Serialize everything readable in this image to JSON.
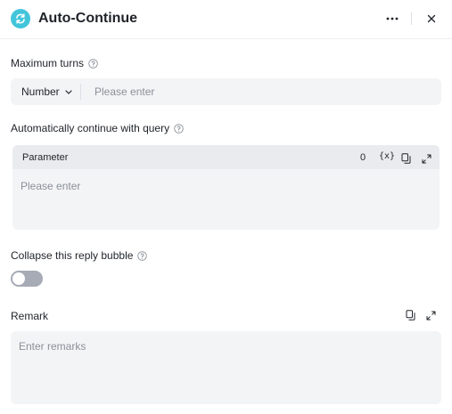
{
  "header": {
    "title": "Auto-Continue",
    "app_icon": "sync-arrows-icon",
    "more_icon": "more-horizontal-icon",
    "close_icon": "close-icon",
    "accent": "#42c5db"
  },
  "max_turns": {
    "label": "Maximum turns",
    "type_select": "Number",
    "placeholder": "Please enter",
    "value": ""
  },
  "query": {
    "label": "Automatically continue with query",
    "parameter_title": "Parameter",
    "count": "0",
    "variable_button": "{x}",
    "placeholder": "Please enter",
    "value": ""
  },
  "collapse": {
    "label": "Collapse this reply bubble",
    "toggle_on": false
  },
  "remark": {
    "label": "Remark",
    "placeholder": "Enter remarks",
    "value": ""
  }
}
